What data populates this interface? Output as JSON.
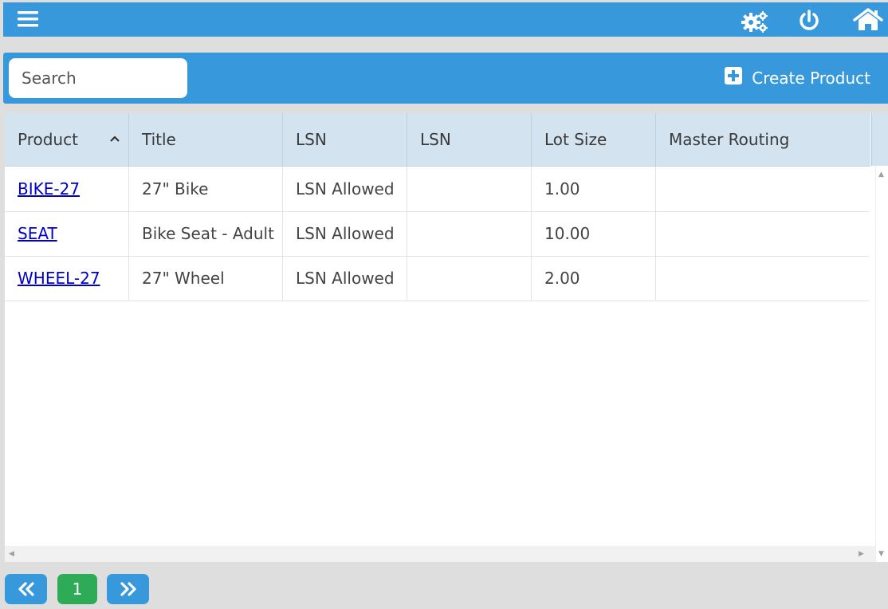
{
  "topbar": {
    "icons": [
      "menu-icon",
      "settings-icon",
      "power-icon",
      "home-icon"
    ]
  },
  "toolbar": {
    "search_placeholder": "Search",
    "create_label": "Create Product"
  },
  "table": {
    "columns": [
      "Product",
      "Title",
      "LSN",
      "LSN",
      "Lot Size",
      "Master Routing"
    ],
    "sorted_column": "Product",
    "sort_direction": "ascending",
    "rows": [
      {
        "product": "BIKE-27",
        "title": "27\" Bike",
        "lsn": "LSN Allowed",
        "lsn2": "",
        "lot_size": "1.00",
        "master_routing": ""
      },
      {
        "product": "SEAT",
        "title": "Bike Seat - Adult",
        "lsn": "LSN Allowed",
        "lsn2": "",
        "lot_size": "10.00",
        "master_routing": ""
      },
      {
        "product": "WHEEL-27",
        "title": "27\" Wheel",
        "lsn": "LSN Allowed",
        "lsn2": "",
        "lot_size": "2.00",
        "master_routing": ""
      }
    ]
  },
  "pager": {
    "current_page": "1"
  },
  "colors": {
    "primary": "#3898dc",
    "active_page": "#2eab57",
    "header_bg": "#d3e3f0",
    "link": "#0000cc"
  }
}
